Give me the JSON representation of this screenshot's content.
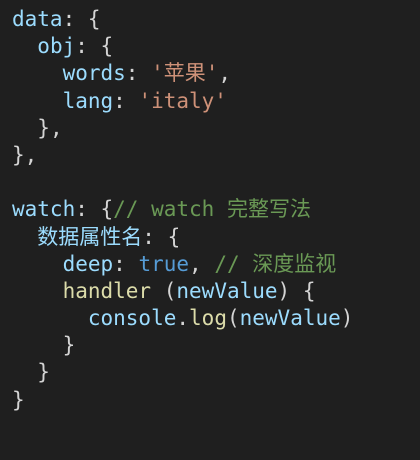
{
  "colors": {
    "background": "#1f1f1f",
    "property": "#9cdcfe",
    "punctuation": "#d4d4d4",
    "string": "#ce9178",
    "keyword": "#569cd6",
    "function": "#dcdcaa",
    "comment": "#6a9955"
  },
  "code": {
    "lines": [
      {
        "indent": "",
        "tokens": [
          {
            "kind": "key",
            "text": "data"
          },
          {
            "kind": "punc",
            "text": ": {"
          }
        ]
      },
      {
        "indent": "  ",
        "tokens": [
          {
            "kind": "key",
            "text": "obj"
          },
          {
            "kind": "punc",
            "text": ": {"
          }
        ]
      },
      {
        "indent": "    ",
        "tokens": [
          {
            "kind": "key",
            "text": "words"
          },
          {
            "kind": "punc",
            "text": ": "
          },
          {
            "kind": "str",
            "text": "'苹果'"
          },
          {
            "kind": "punc",
            "text": ","
          }
        ]
      },
      {
        "indent": "    ",
        "tokens": [
          {
            "kind": "key",
            "text": "lang"
          },
          {
            "kind": "punc",
            "text": ": "
          },
          {
            "kind": "str",
            "text": "'italy'"
          }
        ]
      },
      {
        "indent": "  ",
        "tokens": [
          {
            "kind": "punc",
            "text": "},"
          }
        ]
      },
      {
        "indent": "",
        "tokens": [
          {
            "kind": "punc",
            "text": "},"
          }
        ]
      },
      {
        "indent": "",
        "tokens": []
      },
      {
        "indent": "",
        "tokens": [
          {
            "kind": "key",
            "text": "watch"
          },
          {
            "kind": "punc",
            "text": ": {"
          },
          {
            "kind": "comment",
            "text": "// watch 完整写法"
          }
        ]
      },
      {
        "indent": "  ",
        "tokens": [
          {
            "kind": "key",
            "text": "数据属性名"
          },
          {
            "kind": "punc",
            "text": ": {"
          }
        ]
      },
      {
        "indent": "    ",
        "tokens": [
          {
            "kind": "key",
            "text": "deep"
          },
          {
            "kind": "punc",
            "text": ": "
          },
          {
            "kind": "const",
            "text": "true"
          },
          {
            "kind": "punc",
            "text": ", "
          },
          {
            "kind": "comment",
            "text": "// 深度监视"
          }
        ]
      },
      {
        "indent": "    ",
        "tokens": [
          {
            "kind": "func",
            "text": "handler"
          },
          {
            "kind": "punc",
            "text": " ("
          },
          {
            "kind": "key",
            "text": "newValue"
          },
          {
            "kind": "punc",
            "text": ") {"
          }
        ]
      },
      {
        "indent": "      ",
        "tokens": [
          {
            "kind": "key",
            "text": "console"
          },
          {
            "kind": "punc",
            "text": "."
          },
          {
            "kind": "func",
            "text": "log"
          },
          {
            "kind": "punc",
            "text": "("
          },
          {
            "kind": "key",
            "text": "newValue"
          },
          {
            "kind": "punc",
            "text": ")"
          }
        ]
      },
      {
        "indent": "    ",
        "tokens": [
          {
            "kind": "punc",
            "text": "}"
          }
        ]
      },
      {
        "indent": "  ",
        "tokens": [
          {
            "kind": "punc",
            "text": "}"
          }
        ]
      },
      {
        "indent": "",
        "tokens": [
          {
            "kind": "punc",
            "text": "}"
          }
        ]
      }
    ]
  }
}
